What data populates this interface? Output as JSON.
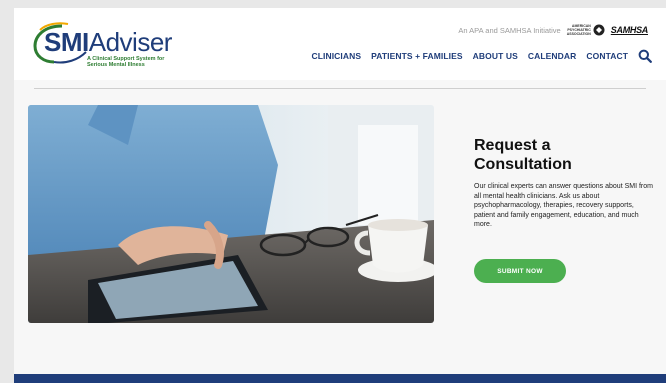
{
  "brand": {
    "logo_smi": "SMI",
    "logo_adviser": "Adviser",
    "tagline_line1": "A Clinical Support System for",
    "tagline_line2": "Serious Mental Illness",
    "primary_color": "#1f3d7a",
    "accent_color": "#4caf50"
  },
  "header": {
    "initiative_text": "An APA and SAMHSA Initiative",
    "apa_line1": "AMERICAN",
    "apa_line2": "PSYCHIATRIC",
    "apa_line3": "ASSOCIATION",
    "samhsa_label": "SAMHSA"
  },
  "nav": {
    "items": [
      {
        "label": "CLINICIANS"
      },
      {
        "label": "PATIENTS + FAMILIES"
      },
      {
        "label": "ABOUT US"
      },
      {
        "label": "CALENDAR"
      },
      {
        "label": "CONTACT"
      }
    ],
    "search_icon": "search-icon"
  },
  "main": {
    "title_line1": "Request a",
    "title_line2": "Consultation",
    "description": "Our clinical experts can answer questions about SMI from all mental health clinicians. Ask us about psychopharmacology, therapies, recovery supports, patient and family engagement, education, and much more.",
    "submit_label": "SUBMIT NOW"
  }
}
